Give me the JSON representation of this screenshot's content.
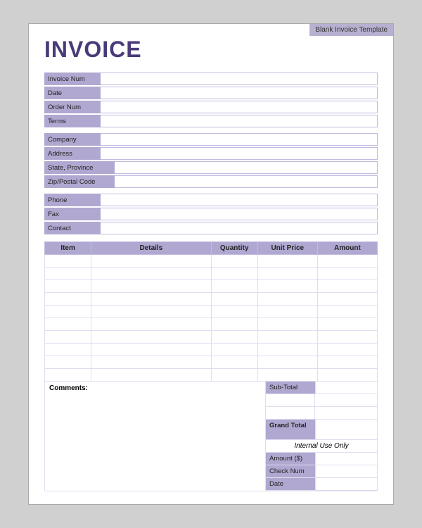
{
  "template": {
    "label": "Blank Invoice Template"
  },
  "invoice": {
    "title": "INVOICE"
  },
  "fields": {
    "invoice_num_label": "Invoice Num",
    "date_label": "Date",
    "order_num_label": "Order Num",
    "terms_label": "Terms",
    "company_label": "Company",
    "address_label": "Address",
    "state_province_label": "State, Province",
    "zip_postal_label": "Zip/Postal Code",
    "phone_label": "Phone",
    "fax_label": "Fax",
    "contact_label": "Contact"
  },
  "table": {
    "headers": {
      "item": "Item",
      "details": "Details",
      "quantity": "Quantity",
      "unit_price": "Unit Price",
      "amount": "Amount"
    },
    "rows": 10
  },
  "totals": {
    "sub_total_label": "Sub-Total",
    "grand_total_label": "Grand Total",
    "internal_use": "Internal Use Only",
    "amount_label": "Amount ($)",
    "check_num_label": "Check Num",
    "date_label": "Date"
  },
  "comments": {
    "label": "Comments:"
  }
}
